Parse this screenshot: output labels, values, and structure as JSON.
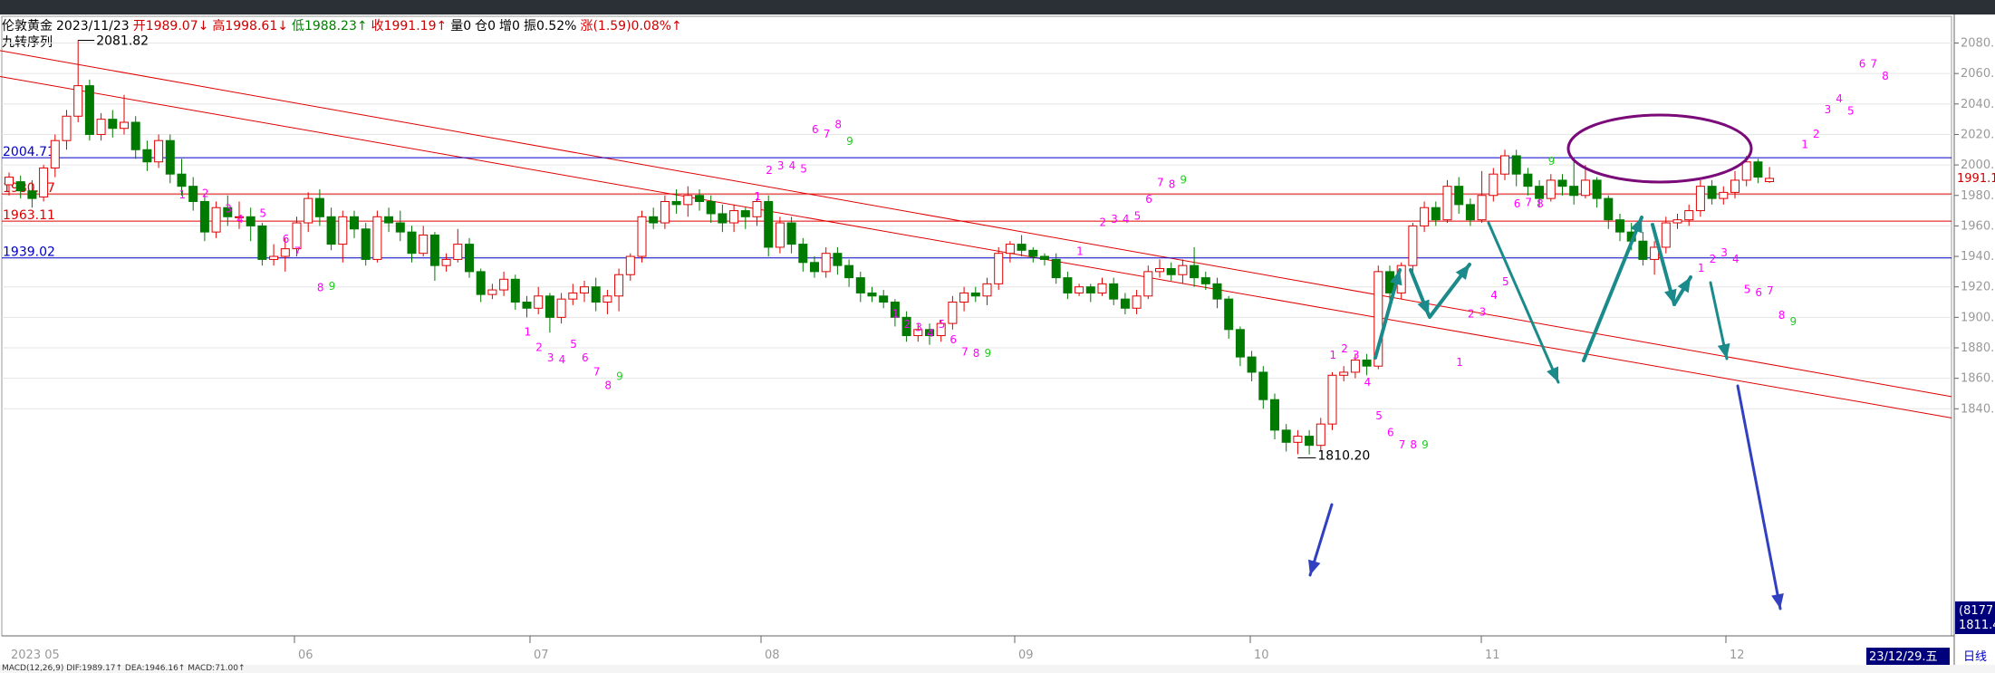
{
  "info": {
    "symbol": "伦敦黄金",
    "date": "2023/11/23",
    "open": "开1989.07↓",
    "high": "高1998.61↓",
    "low": "低1988.23↑",
    "close": "收1991.19↑",
    "volume": "量0",
    "position": "仓0",
    "increase": "增0",
    "amplitude": "振0.52%",
    "change": "涨(1.59)0.08%↑"
  },
  "indicator_name": "九转序列",
  "current_price_label": "1991.1",
  "bottom_left_date": "2023 05",
  "bottom_right_date": "23/12/29.五",
  "period_label": "日线",
  "right_box_values": [
    "(8177",
    "1811.4"
  ],
  "bottom_indicator_text": "MACD(12,26,9)  DIF:1989.17↑  DEA:1946.16↑  MACD:71.00↑",
  "colors": {
    "up": "#e00000",
    "down": "#007a00",
    "td_sell": "#ff00ff",
    "td_final": "#22cc22",
    "h_red": "#e00000",
    "h_blue": "#0000c8",
    "trend": "#e00000",
    "arrow_teal": "#1a8a8a",
    "arrow_blue": "#3040c0",
    "ellipse": "#7a0a7a"
  },
  "chart_data": {
    "type": "candlestick",
    "y_ticks": [
      1840,
      1860,
      1880,
      1900,
      1920,
      1940,
      1960,
      1980,
      2000,
      2020,
      2040,
      2060,
      2080
    ],
    "ylim": [
      1805,
      2090
    ],
    "x_ticks": [
      "06",
      "07",
      "08",
      "09",
      "10",
      "11",
      "12"
    ],
    "annotations": {
      "high": "2081.82",
      "low": "1810.20"
    },
    "h_levels": [
      {
        "label": "2004.71",
        "value": 2004.71,
        "color": "blue"
      },
      {
        "label": "1980.97",
        "value": 1980.97,
        "color": "red"
      },
      {
        "label": "1963.11",
        "value": 1963.11,
        "color": "red"
      },
      {
        "label": "1939.02",
        "value": 1939.02,
        "color": "blue"
      }
    ],
    "candles": [
      [
        1987,
        1992,
        1980,
        1995
      ],
      [
        1989,
        1983,
        1978,
        1993
      ],
      [
        1983,
        1978,
        1972,
        1990
      ],
      [
        1979,
        1998,
        1976,
        2000
      ],
      [
        1998,
        2016,
        1992,
        2020
      ],
      [
        2016,
        2032,
        2010,
        2036
      ],
      [
        2032,
        2052,
        2028,
        2081.82
      ],
      [
        2052,
        2020,
        2016,
        2056
      ],
      [
        2020,
        2030,
        2016,
        2034
      ],
      [
        2030,
        2024,
        2018,
        2036
      ],
      [
        2024,
        2028,
        2020,
        2046
      ],
      [
        2028,
        2010,
        2004,
        2032
      ],
      [
        2010,
        2002,
        1996,
        2016
      ],
      [
        2002,
        2016,
        1998,
        2020
      ],
      [
        2016,
        1994,
        1988,
        2020
      ],
      [
        1994,
        1986,
        1980,
        2004
      ],
      [
        1986,
        1976,
        1970,
        1992
      ],
      [
        1976,
        1956,
        1950,
        1980
      ],
      [
        1956,
        1972,
        1952,
        1976
      ],
      [
        1972,
        1966,
        1960,
        1980
      ],
      [
        1966,
        1966,
        1958,
        1976
      ],
      [
        1966,
        1960,
        1950,
        1972
      ],
      [
        1960,
        1938,
        1934,
        1962
      ],
      [
        1938,
        1940,
        1934,
        1948
      ],
      [
        1940,
        1945,
        1930,
        1952
      ],
      [
        1945,
        1962,
        1940,
        1966
      ],
      [
        1962,
        1978,
        1956,
        1982
      ],
      [
        1978,
        1966,
        1960,
        1984
      ],
      [
        1966,
        1948,
        1944,
        1972
      ],
      [
        1948,
        1966,
        1936,
        1970
      ],
      [
        1966,
        1958,
        1952,
        1970
      ],
      [
        1958,
        1938,
        1934,
        1962
      ],
      [
        1938,
        1966,
        1936,
        1970
      ],
      [
        1966,
        1962,
        1956,
        1972
      ],
      [
        1962,
        1956,
        1950,
        1970
      ],
      [
        1956,
        1942,
        1936,
        1960
      ],
      [
        1942,
        1954,
        1940,
        1960
      ],
      [
        1954,
        1934,
        1924,
        1956
      ],
      [
        1934,
        1938,
        1930,
        1942
      ],
      [
        1938,
        1948,
        1936,
        1958
      ],
      [
        1948,
        1930,
        1926,
        1952
      ],
      [
        1930,
        1915,
        1910,
        1932
      ],
      [
        1915,
        1918,
        1912,
        1922
      ],
      [
        1918,
        1925,
        1914,
        1930
      ],
      [
        1925,
        1910,
        1905,
        1928
      ],
      [
        1910,
        1906,
        1900,
        1914
      ],
      [
        1906,
        1914,
        1902,
        1920
      ],
      [
        1914,
        1900,
        1890,
        1916
      ],
      [
        1900,
        1912,
        1896,
        1916
      ],
      [
        1912,
        1916,
        1908,
        1922
      ],
      [
        1916,
        1920,
        1910,
        1924
      ],
      [
        1920,
        1910,
        1904,
        1926
      ],
      [
        1910,
        1914,
        1902,
        1918
      ],
      [
        1914,
        1928,
        1904,
        1932
      ],
      [
        1928,
        1940,
        1924,
        1942
      ],
      [
        1940,
        1966,
        1936,
        1970
      ],
      [
        1966,
        1962,
        1958,
        1972
      ],
      [
        1962,
        1976,
        1958,
        1980
      ],
      [
        1976,
        1974,
        1968,
        1984
      ],
      [
        1974,
        1980,
        1966,
        1986
      ],
      [
        1980,
        1976,
        1970,
        1984
      ],
      [
        1976,
        1968,
        1962,
        1980
      ],
      [
        1968,
        1962,
        1956,
        1974
      ],
      [
        1962,
        1970,
        1956,
        1974
      ],
      [
        1970,
        1966,
        1958,
        1972
      ],
      [
        1966,
        1976,
        1960,
        1978
      ],
      [
        1976,
        1946,
        1940,
        1980
      ],
      [
        1946,
        1962,
        1942,
        1966
      ],
      [
        1962,
        1948,
        1942,
        1966
      ],
      [
        1948,
        1936,
        1930,
        1952
      ],
      [
        1936,
        1930,
        1926,
        1940
      ],
      [
        1930,
        1942,
        1926,
        1946
      ],
      [
        1942,
        1934,
        1928,
        1946
      ],
      [
        1934,
        1926,
        1920,
        1938
      ],
      [
        1926,
        1916,
        1910,
        1930
      ],
      [
        1916,
        1914,
        1910,
        1920
      ],
      [
        1914,
        1910,
        1906,
        1918
      ],
      [
        1910,
        1900,
        1894,
        1912
      ],
      [
        1900,
        1888,
        1884,
        1904
      ],
      [
        1888,
        1892,
        1884,
        1896
      ],
      [
        1892,
        1888,
        1882,
        1896
      ],
      [
        1888,
        1896,
        1884,
        1898
      ],
      [
        1896,
        1910,
        1892,
        1914
      ],
      [
        1910,
        1916,
        1904,
        1920
      ],
      [
        1916,
        1914,
        1910,
        1920
      ],
      [
        1914,
        1922,
        1908,
        1926
      ],
      [
        1922,
        1942,
        1918,
        1946
      ],
      [
        1942,
        1948,
        1936,
        1950
      ],
      [
        1948,
        1944,
        1940,
        1954
      ],
      [
        1944,
        1940,
        1936,
        1946
      ],
      [
        1940,
        1938,
        1934,
        1942
      ],
      [
        1938,
        1926,
        1922,
        1942
      ],
      [
        1926,
        1916,
        1912,
        1930
      ],
      [
        1916,
        1920,
        1914,
        1922
      ],
      [
        1920,
        1916,
        1910,
        1922
      ],
      [
        1916,
        1922,
        1914,
        1926
      ],
      [
        1922,
        1912,
        1908,
        1926
      ],
      [
        1912,
        1906,
        1902,
        1916
      ],
      [
        1906,
        1914,
        1902,
        1918
      ],
      [
        1914,
        1930,
        1912,
        1934
      ],
      [
        1930,
        1932,
        1926,
        1938
      ],
      [
        1932,
        1928,
        1924,
        1936
      ],
      [
        1928,
        1934,
        1922,
        1938
      ],
      [
        1934,
        1926,
        1920,
        1946
      ],
      [
        1926,
        1922,
        1918,
        1930
      ],
      [
        1922,
        1912,
        1906,
        1926
      ],
      [
        1912,
        1892,
        1886,
        1914
      ],
      [
        1892,
        1874,
        1868,
        1894
      ],
      [
        1874,
        1864,
        1858,
        1878
      ],
      [
        1864,
        1846,
        1840,
        1868
      ],
      [
        1846,
        1826,
        1820,
        1850
      ],
      [
        1826,
        1818,
        1812,
        1830
      ],
      [
        1818,
        1822,
        1810.2,
        1826
      ],
      [
        1822,
        1816,
        1810,
        1826
      ],
      [
        1816,
        1830,
        1812,
        1834
      ],
      [
        1830,
        1862,
        1826,
        1864
      ],
      [
        1862,
        1864,
        1858,
        1868
      ],
      [
        1864,
        1872,
        1860,
        1876
      ],
      [
        1872,
        1868,
        1862,
        1876
      ],
      [
        1868,
        1930,
        1866,
        1934
      ],
      [
        1930,
        1916,
        1910,
        1934
      ],
      [
        1916,
        1934,
        1912,
        1936
      ],
      [
        1934,
        1960,
        1930,
        1962
      ],
      [
        1960,
        1972,
        1956,
        1976
      ],
      [
        1972,
        1964,
        1960,
        1976
      ],
      [
        1964,
        1986,
        1962,
        1990
      ],
      [
        1986,
        1974,
        1968,
        1992
      ],
      [
        1974,
        1964,
        1960,
        1978
      ],
      [
        1964,
        1980,
        1962,
        1996
      ],
      [
        1980,
        1994,
        1976,
        1998
      ],
      [
        1994,
        2006,
        1990,
        2010
      ],
      [
        2006,
        1994,
        1986,
        2010
      ],
      [
        1994,
        1986,
        1980,
        1998
      ],
      [
        1986,
        1978,
        1972,
        1990
      ],
      [
        1978,
        1990,
        1976,
        1994
      ],
      [
        1990,
        1986,
        1980,
        1994
      ],
      [
        1986,
        1980,
        1974,
        2004
      ],
      [
        1980,
        1990,
        1978,
        2000
      ],
      [
        1990,
        1978,
        1972,
        1992
      ],
      [
        1978,
        1964,
        1958,
        1980
      ],
      [
        1964,
        1956,
        1950,
        1968
      ],
      [
        1956,
        1950,
        1944,
        1962
      ],
      [
        1950,
        1938,
        1934,
        1956
      ],
      [
        1938,
        1946,
        1928,
        1950
      ],
      [
        1946,
        1962,
        1942,
        1966
      ],
      [
        1962,
        1964,
        1958,
        1968
      ],
      [
        1964,
        1970,
        1960,
        1974
      ],
      [
        1970,
        1986,
        1966,
        1990
      ],
      [
        1986,
        1978,
        1974,
        1990
      ],
      [
        1978,
        1982,
        1974,
        1986
      ],
      [
        1982,
        1990,
        1978,
        1996
      ],
      [
        1990,
        2002,
        1986,
        2006
      ],
      [
        2002,
        1992,
        1988,
        2004
      ],
      [
        1989.07,
        1991.19,
        1988.23,
        1998.61
      ]
    ],
    "td_labels": [
      [
        15,
        1978,
        "1"
      ],
      [
        17,
        1979,
        "2"
      ],
      [
        19,
        1969,
        "3"
      ],
      [
        20,
        1962,
        "4"
      ],
      [
        22,
        1966,
        "5"
      ],
      [
        24,
        1949,
        "6"
      ],
      [
        25,
        1941,
        "7"
      ],
      [
        27,
        1917,
        "8"
      ],
      [
        28,
        1918,
        "9"
      ],
      [
        45,
        1888,
        "1"
      ],
      [
        46,
        1878,
        "2"
      ],
      [
        47,
        1871,
        "3"
      ],
      [
        48,
        1870,
        "4"
      ],
      [
        49,
        1880,
        "5"
      ],
      [
        50,
        1871,
        "6"
      ],
      [
        51,
        1862,
        "7"
      ],
      [
        52,
        1853,
        "8"
      ],
      [
        53,
        1859,
        "9"
      ],
      [
        65,
        1977,
        "1"
      ],
      [
        66,
        1994,
        "2"
      ],
      [
        67,
        1997,
        "3"
      ],
      [
        68,
        1997,
        "4"
      ],
      [
        69,
        1995,
        "5"
      ],
      [
        70,
        2021,
        "6"
      ],
      [
        71,
        2018,
        "7"
      ],
      [
        72,
        2024,
        "8"
      ],
      [
        73,
        2013,
        "9"
      ],
      [
        77,
        1900,
        "1"
      ],
      [
        78,
        1893,
        "2"
      ],
      [
        79,
        1891,
        "3"
      ],
      [
        80,
        1887,
        "4"
      ],
      [
        81,
        1893,
        "5"
      ],
      [
        82,
        1883,
        "6"
      ],
      [
        83,
        1875,
        "7"
      ],
      [
        84,
        1874,
        "8"
      ],
      [
        85,
        1874,
        "9"
      ],
      [
        93,
        1941,
        "1"
      ],
      [
        95,
        1960,
        "2"
      ],
      [
        96,
        1962,
        "3"
      ],
      [
        97,
        1962,
        "4"
      ],
      [
        98,
        1964,
        "5"
      ],
      [
        99,
        1975,
        "6"
      ],
      [
        100,
        1986,
        "7"
      ],
      [
        101,
        1985,
        "8"
      ],
      [
        102,
        1988,
        "9"
      ],
      [
        115,
        1873,
        "1"
      ],
      [
        116,
        1877,
        "2"
      ],
      [
        117,
        1873,
        "3"
      ],
      [
        118,
        1855,
        "4"
      ],
      [
        119,
        1833,
        "5"
      ],
      [
        120,
        1822,
        "6"
      ],
      [
        121,
        1814,
        "7"
      ],
      [
        122,
        1814,
        "8"
      ],
      [
        123,
        1814,
        "9"
      ],
      [
        126,
        1868,
        "1"
      ],
      [
        127,
        1900,
        "2"
      ],
      [
        128,
        1901,
        "3"
      ],
      [
        129,
        1912,
        "4"
      ],
      [
        130,
        1921,
        "5"
      ],
      [
        131,
        1972,
        "6"
      ],
      [
        132,
        1973,
        "7"
      ],
      [
        133,
        1972,
        "8"
      ],
      [
        134,
        2000,
        "9"
      ],
      [
        147,
        1930,
        "1"
      ],
      [
        148,
        1936,
        "2"
      ],
      [
        149,
        1940,
        "3"
      ],
      [
        150,
        1936,
        "4"
      ],
      [
        151,
        1916,
        "5"
      ],
      [
        152,
        1914,
        "6"
      ],
      [
        153,
        1915,
        "7"
      ],
      [
        154,
        1899,
        "8"
      ],
      [
        155,
        1895,
        "9"
      ],
      [
        156,
        2011,
        "1"
      ],
      [
        157,
        2018,
        "2"
      ],
      [
        158,
        2034,
        "3"
      ],
      [
        159,
        2041,
        "4"
      ],
      [
        160,
        2033,
        "5"
      ],
      [
        161,
        2064,
        "6"
      ],
      [
        162,
        2064,
        "7"
      ],
      [
        163,
        2056,
        "8"
      ]
    ]
  }
}
